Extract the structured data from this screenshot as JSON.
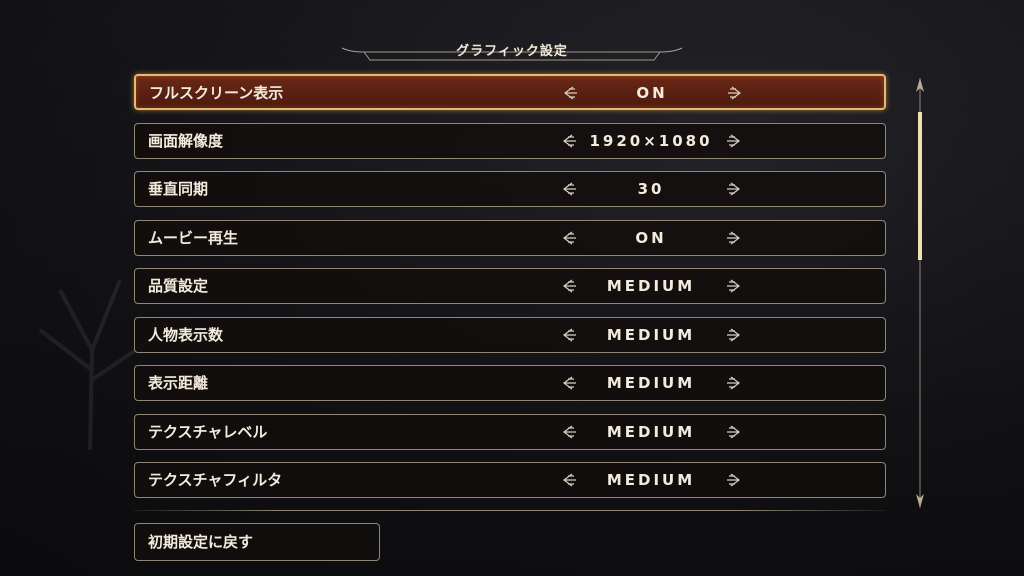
{
  "header": {
    "title": "グラフィック設定"
  },
  "settings": [
    {
      "label": "フルスクリーン表示",
      "value": "ON"
    },
    {
      "label": "画面解像度",
      "value": "1920×1080"
    },
    {
      "label": "垂直同期",
      "value": "30"
    },
    {
      "label": "ムービー再生",
      "value": "ON"
    },
    {
      "label": "品質設定",
      "value": "MEDIUM"
    },
    {
      "label": "人物表示数",
      "value": "MEDIUM"
    },
    {
      "label": "表示距離",
      "value": "MEDIUM"
    },
    {
      "label": "テクスチャレベル",
      "value": "MEDIUM"
    },
    {
      "label": "テクスチャフィルタ",
      "value": "MEDIUM"
    }
  ],
  "selected_index": 0,
  "footer": {
    "reset_label": "初期設定に戻す"
  },
  "icons": {
    "left": "arrow-left-icon",
    "right": "arrow-right-icon"
  },
  "colors": {
    "selected_fill": "#5a2112",
    "selected_border": "#e9b86a",
    "row_border": "#8f8676",
    "text": "#f3ecdc"
  }
}
